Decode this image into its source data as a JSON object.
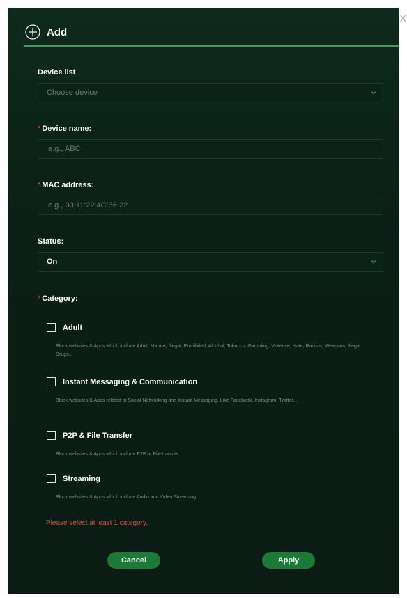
{
  "dialog": {
    "close_label": "X",
    "title": "Add",
    "error": "Please select at least 1 category.",
    "cancel_label": "Cancel",
    "apply_label": "Apply"
  },
  "device_list": {
    "label": "Device list",
    "placeholder": "Choose device"
  },
  "device_name": {
    "required_mark": "*",
    "label": "Device name:",
    "placeholder": "e.g., ABC"
  },
  "mac_address": {
    "required_mark": "*",
    "label": "MAC address:",
    "placeholder": "e.g., 00:11:22:4C:36:22"
  },
  "status": {
    "label": "Status:",
    "value": "On"
  },
  "category": {
    "required_mark": "*",
    "label": "Category:",
    "items": [
      {
        "title": "Adult",
        "description": "Block websites & Apps which include Adult, Mature, Illegal, Prohibited, Alcohol, Tobacco, Gambling, Violence, Hate, Racism, Weapons, Illegal Drugs...",
        "checked": false
      },
      {
        "title": "Instant Messaging & Communication",
        "description": "Block websites & Apps related to Social Networking and Instant Messaging. Like Facebook, Instagram, Twitter...",
        "checked": false
      },
      {
        "title": "P2P & File Transfer",
        "description": "Block websites & Apps which include P2P or File transfer.",
        "checked": false
      },
      {
        "title": "Streaming",
        "description": "Block websites & Apps which include Audio and Video Streaming.",
        "checked": false
      }
    ]
  },
  "colors": {
    "accent": "#2fa84a",
    "button": "#1b7a36",
    "error": "#e2503f",
    "background": "#0b2317"
  },
  "icons": {
    "add": "plus-circle-icon",
    "dropdown": "chevron-down-icon",
    "close": "close-icon"
  }
}
